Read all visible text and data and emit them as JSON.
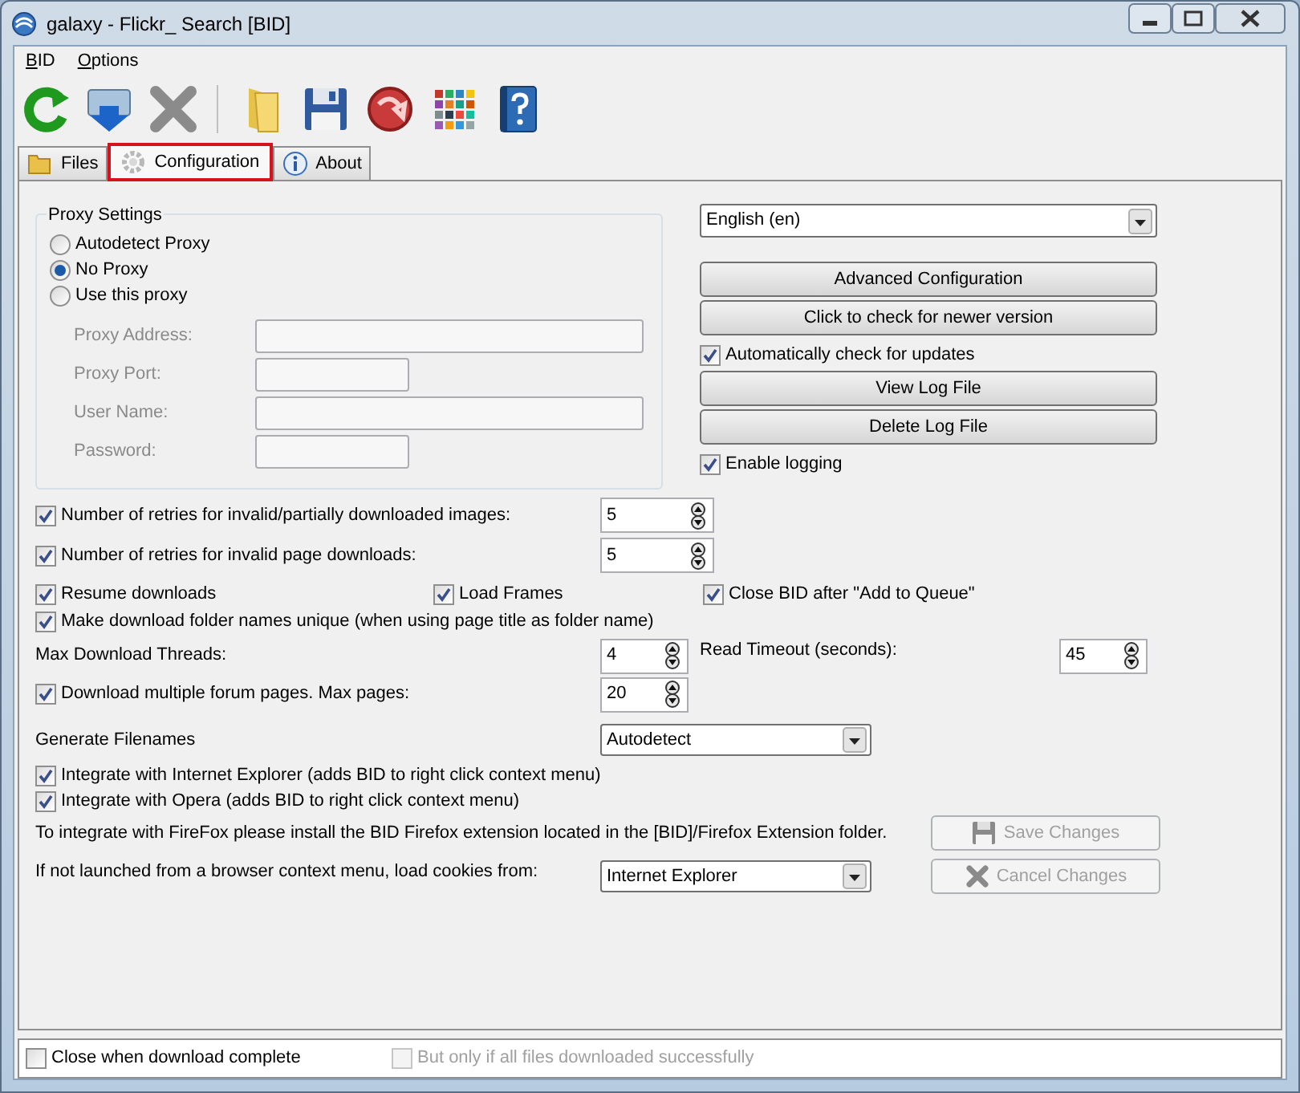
{
  "window": {
    "title": "galaxy - Flickr_ Search [BID]"
  },
  "menu": [
    {
      "label": "BID"
    },
    {
      "label": "Options"
    }
  ],
  "tabs": [
    {
      "label": "Files",
      "selected": false
    },
    {
      "label": "Configuration",
      "selected": true
    },
    {
      "label": "About",
      "selected": false
    }
  ],
  "proxy": {
    "title": "Proxy Settings",
    "options": [
      {
        "label": "Autodetect Proxy",
        "selected": false
      },
      {
        "label": "No Proxy",
        "selected": true
      },
      {
        "label": "Use this proxy",
        "selected": false
      }
    ],
    "fields": [
      {
        "label": "Proxy Address:",
        "wide": true,
        "disabled": true
      },
      {
        "label": "Proxy Port:",
        "wide": false,
        "disabled": true
      },
      {
        "label": "User Name:",
        "wide": true,
        "disabled": true
      },
      {
        "label": "Password:",
        "wide": false,
        "disabled": true
      }
    ]
  },
  "language": {
    "value": "English (en)"
  },
  "right_controls": [
    {
      "kind": "button",
      "label": "Advanced Configuration"
    },
    {
      "kind": "button",
      "label": "Click to check for newer version"
    },
    {
      "kind": "checkbox",
      "label": "Automatically check for updates",
      "checked": true
    },
    {
      "kind": "button",
      "label": "View Log File"
    },
    {
      "kind": "button",
      "label": "Delete Log File"
    },
    {
      "kind": "checkbox",
      "label": "Enable logging",
      "checked": true
    }
  ],
  "retries": [
    {
      "label": "Number of retries for invalid/partially downloaded images:",
      "checked": true,
      "value": "5"
    },
    {
      "label": "Number of retries for invalid page downloads:",
      "checked": true,
      "value": "5"
    }
  ],
  "options_row": [
    {
      "label": "Resume downloads",
      "checked": true
    },
    {
      "label": "Load Frames",
      "checked": true
    },
    {
      "label": "Close BID after \"Add to Queue\"",
      "checked": true
    }
  ],
  "unique_names": {
    "label": "Make download folder names unique (when using page title as folder name)",
    "checked": true
  },
  "max_threads": {
    "label": "Max Download Threads:",
    "value": "4"
  },
  "read_timeout": {
    "label": "Read Timeout (seconds):",
    "value": "45"
  },
  "max_pages": {
    "label": "Download multiple forum pages. Max pages:",
    "checked": true,
    "value": "20"
  },
  "generate_filenames": {
    "label": "Generate Filenames",
    "value": "Autodetect"
  },
  "integrations": [
    {
      "label": "Integrate with Internet Explorer (adds BID to right click context menu)",
      "checked": true
    },
    {
      "label": "Integrate with Opera (adds BID to right click context menu)",
      "checked": true
    }
  ],
  "firefox_note": "To integrate with FireFox please install the BID Firefox extension located in the [BID]/Firefox Extension folder.",
  "save_button": {
    "label": "Save Changes",
    "disabled": true
  },
  "cookies": {
    "label": "If not launched from a browser context menu, load cookies from:",
    "value": "Internet Explorer"
  },
  "cancel_button": {
    "label": "Cancel Changes",
    "disabled": true
  },
  "footer": [
    {
      "label": "Close when download complete",
      "checked": false,
      "disabled": false
    },
    {
      "label": "But only if all files downloaded successfully",
      "checked": false,
      "disabled": true
    }
  ]
}
